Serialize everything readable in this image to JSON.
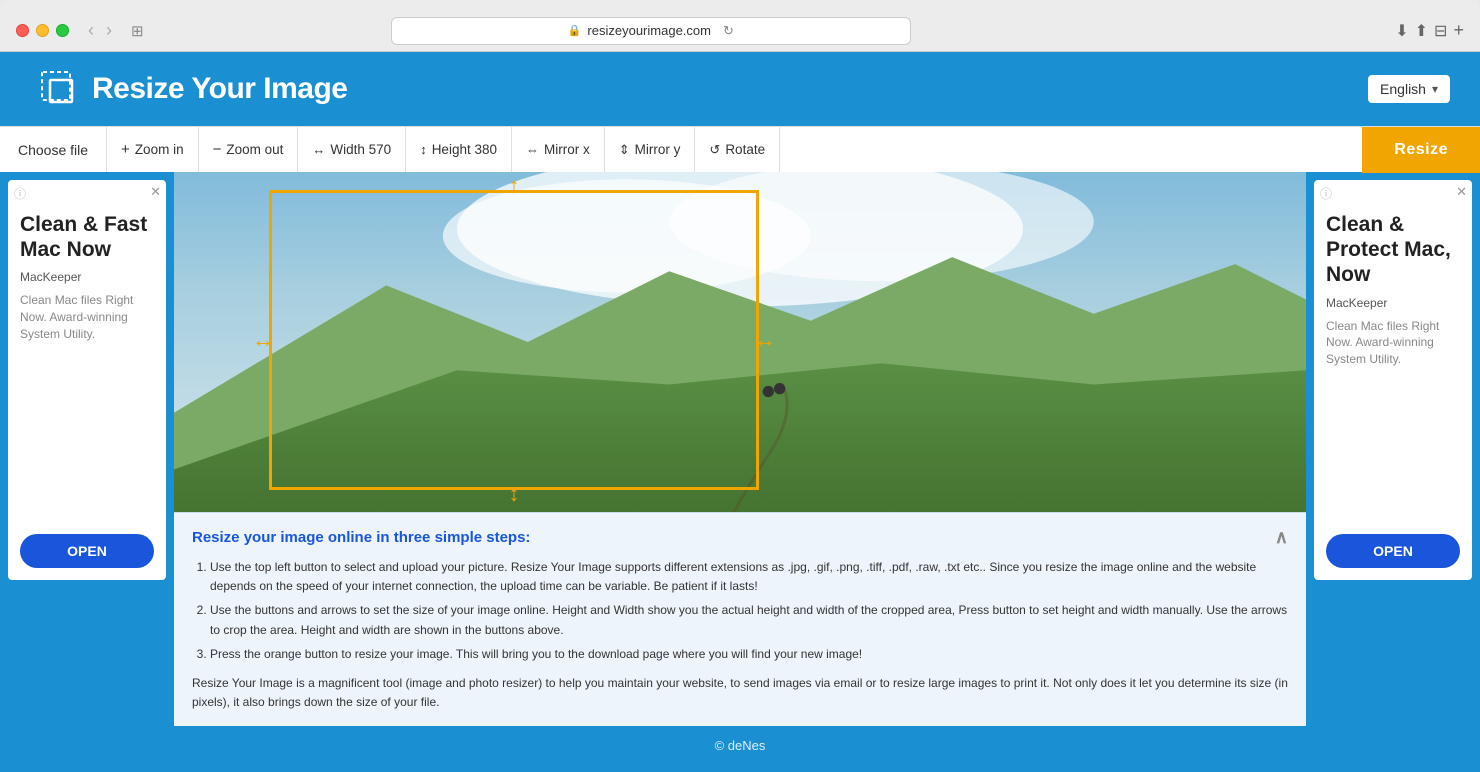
{
  "browser": {
    "url": "resizeyourimage.com",
    "back_label": "‹",
    "forward_label": "›",
    "tab_label": "⊞",
    "add_tab_label": "+"
  },
  "header": {
    "logo_text": "Resize Your Image",
    "lang_label": "English",
    "lang_arrow": "▾"
  },
  "toolbar": {
    "choose_file": "Choose file",
    "zoom_in": "Zoom in",
    "zoom_out": "Zoom out",
    "width": "Width 570",
    "height": "Height 380",
    "mirror_x": "Mirror x",
    "mirror_y": "Mirror y",
    "rotate": "Rotate",
    "resize": "Resize"
  },
  "ad_left": {
    "title": "Clean & Fast Mac Now",
    "brand": "MacKeeper",
    "desc": "Clean Mac files Right Now. Award-winning System Utility.",
    "open_btn": "OPEN"
  },
  "ad_right": {
    "title": "Clean & Protect Mac, Now",
    "brand": "MacKeeper",
    "desc": "Clean Mac files Right Now. Award-winning System Utility.",
    "open_btn": "OPEN"
  },
  "info": {
    "title": "Resize your image online in three simple steps:",
    "step1": "Use the top left button to select and upload your picture. Resize Your Image supports different extensions as .jpg, .gif, .png, .tiff, .pdf, .raw, .txt etc.. Since you resize the image online and the website depends on the speed of your internet connection, the upload time can be variable. Be patient if it lasts!",
    "step2": "Use the buttons and arrows to set the size of your image online. Height and Width show you the actual height and width of the cropped area, Press button to set height and width manually. Use the arrows to crop the area. Height and width are shown in the buttons above.",
    "step3": "Press the orange button to resize your image. This will bring you to the download page where you will find your new image!",
    "desc": "Resize Your Image is a magnificent tool (image and photo resizer) to help you maintain your website, to send images via email or to resize large images to print it. Not only does it let you determine its size (in pixels), it also brings down the size of your file."
  },
  "footer": {
    "copyright": "© deNes"
  }
}
